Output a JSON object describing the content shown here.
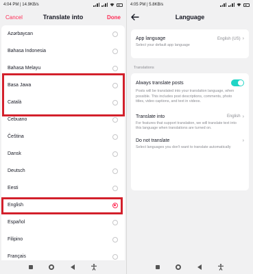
{
  "left": {
    "status": {
      "time": "4:04 PM",
      "speed": "14.9KB/s",
      "battery": "84"
    },
    "header": {
      "cancel_label": "Cancel",
      "title": "Translate into",
      "done_label": "Done"
    },
    "languages": [
      {
        "label": "Azərbaycan",
        "selected": false
      },
      {
        "label": "Bahasa Indonesia",
        "selected": false
      },
      {
        "label": "Bahasa Melayu",
        "selected": false
      },
      {
        "label": "Basa Jawa",
        "selected": false
      },
      {
        "label": "Català",
        "selected": false
      },
      {
        "label": "Cebuano",
        "selected": false
      },
      {
        "label": "Čeština",
        "selected": false
      },
      {
        "label": "Dansk",
        "selected": false
      },
      {
        "label": "Deutsch",
        "selected": false
      },
      {
        "label": "Eesti",
        "selected": false
      },
      {
        "label": "English",
        "selected": true
      },
      {
        "label": "Español",
        "selected": false
      },
      {
        "label": "Filipino",
        "selected": false
      },
      {
        "label": "Français",
        "selected": false
      }
    ]
  },
  "right": {
    "status": {
      "time": "4:05 PM",
      "speed": "5.8KB/s",
      "battery": "84"
    },
    "header": {
      "title": "Language"
    },
    "app_language": {
      "title": "App language",
      "value": "English (US)",
      "description": "Select your default app language"
    },
    "translations_label": "Translations",
    "always_translate": {
      "title": "Always translate posts",
      "enabled": true,
      "description": "Posts will be translated into your translation language, when possible. This includes post descriptions, comments, photo titles, video captions, and text in videos."
    },
    "translate_into": {
      "title": "Translate into",
      "value": "English",
      "description": "For features that support translation, we will translate text into this language when translations are turned on."
    },
    "do_not_translate": {
      "title": "Do not translate",
      "description": "Select languages you don't want to translate automatically"
    }
  },
  "colors": {
    "accent": "#fe2c55",
    "toggle_on": "#20d5c6",
    "highlight": "#d3202b",
    "background": "#f1f1f2"
  },
  "icons": [
    "back-arrow-icon",
    "chevron-right-icon",
    "radio-icon",
    "nav-square-icon",
    "nav-home-icon",
    "nav-back-icon",
    "accessibility-icon",
    "signal-icon",
    "wifi-icon",
    "battery-icon"
  ]
}
